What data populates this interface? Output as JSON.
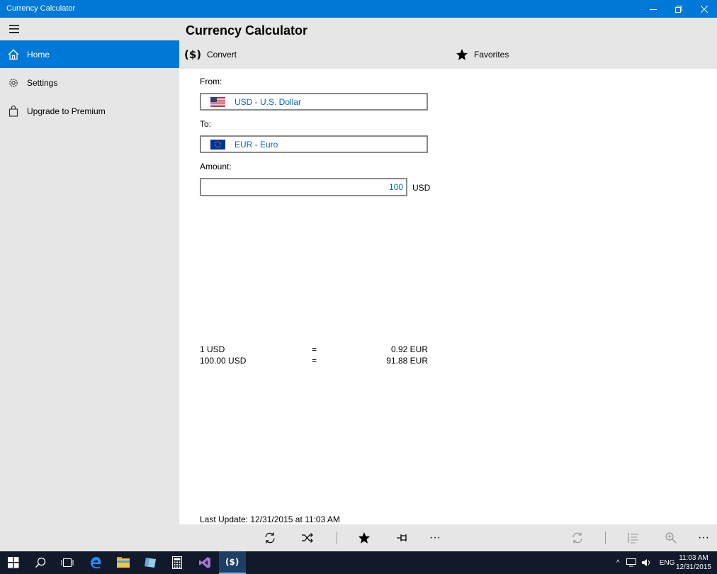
{
  "window": {
    "title": "Currency Calculator"
  },
  "sidebar": {
    "items": [
      {
        "label": "Home",
        "icon": "home-icon",
        "active": true
      },
      {
        "label": "Settings",
        "icon": "gear-icon",
        "active": false
      },
      {
        "label": "Upgrade to Premium",
        "icon": "shopping-bag-icon",
        "active": false
      }
    ]
  },
  "header": {
    "title": "Currency Calculator",
    "tabs": [
      {
        "label": "Convert",
        "icon": "currency-icon"
      },
      {
        "label": "Favorites",
        "icon": "star-icon"
      }
    ]
  },
  "form": {
    "from_label": "From:",
    "from_value": "USD - U.S. Dollar",
    "to_label": "To:",
    "to_value": "EUR - Euro",
    "amount_label": "Amount:",
    "amount_value": "100",
    "amount_unit": "USD"
  },
  "results": [
    {
      "left": "1  USD",
      "eq": "=",
      "right": "0.92 EUR"
    },
    {
      "left": "100.00 USD",
      "eq": "=",
      "right": "91.88 EUR"
    }
  ],
  "last_update": "Last Update: 12/31/2015 at 11:03 AM",
  "commandbar": {
    "buttons": [
      "refresh-icon",
      "shuffle-icon",
      "star-icon",
      "pin-icon",
      "more-icon",
      "refresh-icon",
      "list-icon",
      "zoom-icon",
      "more-icon"
    ],
    "more_glyph": "···"
  },
  "taskbar": {
    "lang": "ENG",
    "time": "11:03 AM",
    "date": "12/31/2015"
  },
  "colors": {
    "accent": "#0078d7",
    "link": "#0067c0",
    "chrome": "#e6e6e6",
    "taskbar": "#101a2a"
  }
}
